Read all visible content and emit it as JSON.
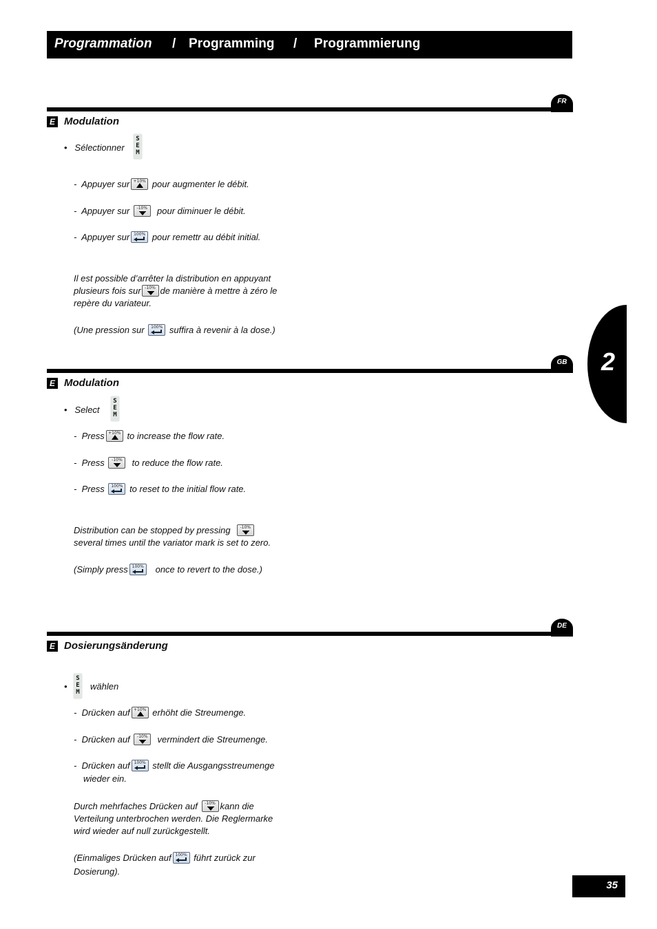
{
  "header": {
    "title_fr": "Programmation",
    "sep1": "/",
    "title_gb": "Programming",
    "sep2": "/",
    "title_de": "Programmierung"
  },
  "chapter": "2",
  "page_number": "35",
  "buttons": {
    "plus": "+10%",
    "minus": "-10%",
    "reset": "100%",
    "sem_letters": [
      "S",
      "E",
      "M"
    ]
  },
  "sections": {
    "fr": {
      "lang": "FR",
      "badge": "E",
      "title": "Modulation",
      "select_bullet": "•",
      "select_text": "Sélectionner",
      "dash": "-",
      "step1_pre": "Appuyer sur",
      "step1_post": "pour augmenter le débit.",
      "step2_pre": "Appuyer sur",
      "step2_post": "pour diminuer le débit.",
      "step3_pre": "Appuyer sur",
      "step3_post": "pour remettr au débit initial.",
      "note1_line1": "Il est possible d’arrêter la distribution en appuyant",
      "note1_line2_pre": "plusieurs fois sur",
      "note1_line2_post": "de manière à mettre à zéro le",
      "note1_line3": "repère du variateur.",
      "note2_pre": "(Une pression sur",
      "note2_post": "suffira à revenir à la dose.)"
    },
    "gb": {
      "lang": "GB",
      "badge": "E",
      "title": "Modulation",
      "select_bullet": "•",
      "select_text": "Select",
      "dash": "-",
      "step1_pre": "Press",
      "step1_post": "to increase the flow rate.",
      "step2_pre": "Press",
      "step2_post": "to reduce the flow rate.",
      "step3_pre": "Press",
      "step3_post": "to reset to the initial flow rate.",
      "note1_line1_pre": "Distribution can be stopped by pressing",
      "note1_line2": "several times until the variator mark is set to zero.",
      "note2_pre": "(Simply press",
      "note2_post": "once to revert to the dose.)"
    },
    "de": {
      "lang": "DE",
      "badge": "E",
      "title": "Dosierungsänderung",
      "select_bullet": "•",
      "select_text": "wählen",
      "dash": "-",
      "step1_pre": "Drücken auf",
      "step1_post": "erhöht die Streumenge.",
      "step2_pre": "Drücken auf",
      "step2_post": "vermindert die Streumenge.",
      "step3_pre": "Drücken auf",
      "step3_post": "stellt die Ausgangsstreumenge",
      "step3_line2": "wieder ein.",
      "note1_line1_pre": "Durch mehrfaches Drücken auf",
      "note1_line1_post": "kann die",
      "note1_line2": "Verteilung unterbrochen werden. Die Reglermarke",
      "note1_line3": "wird wieder auf null zurückgestellt.",
      "note2_pre": "(Einmaliges Drücken auf",
      "note2_post": "führt zurück zur",
      "note2_line2": "Dosierung)."
    }
  }
}
